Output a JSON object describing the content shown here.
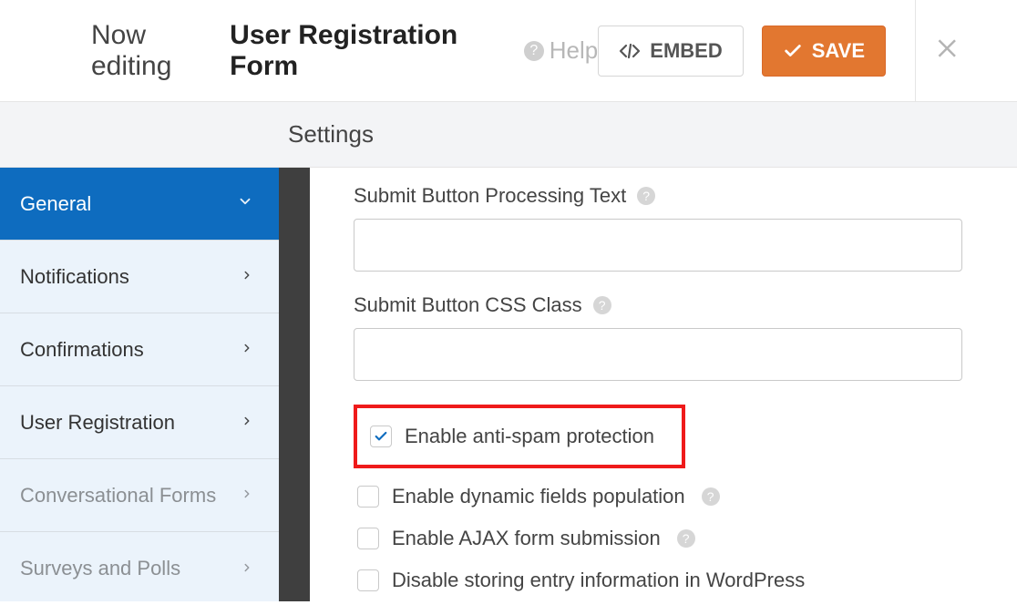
{
  "header": {
    "editing_prefix": "Now editing",
    "form_name": "User Registration Form",
    "help_label": "Help",
    "embed_label": "EMBED",
    "save_label": "SAVE"
  },
  "page_title": "Settings",
  "sidebar": {
    "items": [
      {
        "label": "General",
        "active": true,
        "expanded": true
      },
      {
        "label": "Notifications",
        "active": false
      },
      {
        "label": "Confirmations",
        "active": false
      },
      {
        "label": "User Registration",
        "active": false
      },
      {
        "label": "Conversational Forms",
        "active": false,
        "dim": true
      },
      {
        "label": "Surveys and Polls",
        "active": false,
        "dim": true
      }
    ]
  },
  "form": {
    "submit_processing_label": "Submit Button Processing Text",
    "submit_processing_value": "",
    "submit_css_label": "Submit Button CSS Class",
    "submit_css_value": "",
    "checkboxes": [
      {
        "label": "Enable anti-spam protection",
        "checked": true,
        "highlighted": true,
        "help": false
      },
      {
        "label": "Enable dynamic fields population",
        "checked": false,
        "help": true
      },
      {
        "label": "Enable AJAX form submission",
        "checked": false,
        "help": true
      },
      {
        "label": "Disable storing entry information in WordPress",
        "checked": false,
        "help": false
      }
    ]
  }
}
